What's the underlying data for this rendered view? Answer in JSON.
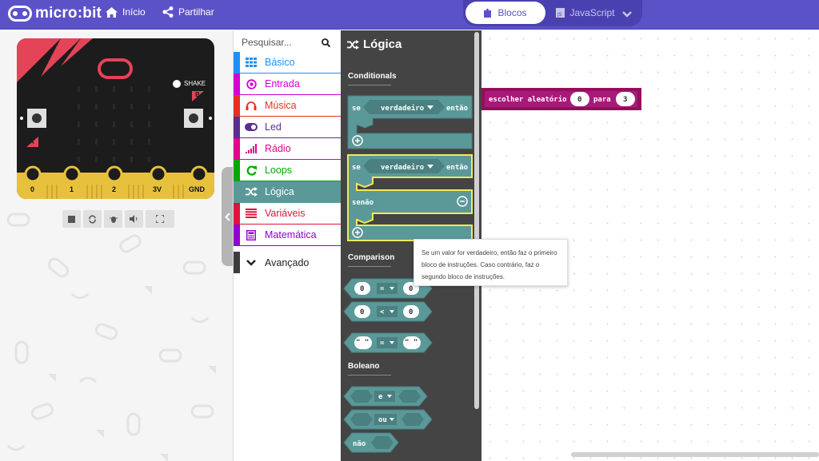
{
  "header": {
    "brand": "micro:bit",
    "home_label": "Início",
    "share_label": "Partilhar",
    "blocks_label": "Blocos",
    "javascript_label": "JavaScript",
    "accent": "#5c52c8"
  },
  "simulator": {
    "shake_label": "SHAKE",
    "button_a": "A",
    "button_b": "B",
    "pins": [
      "0",
      "1",
      "2",
      "3V",
      "GND"
    ],
    "toolbar_icons": [
      "stop-icon",
      "restart-icon",
      "debug-icon",
      "sound-icon",
      "fullscreen-icon"
    ]
  },
  "toolbox": {
    "search_placeholder": "Pesquisar...",
    "categories": [
      {
        "label": "Básico",
        "color": "#1e90ff",
        "icon": "grid-icon"
      },
      {
        "label": "Entrada",
        "color": "#d400d4",
        "icon": "target-icon"
      },
      {
        "label": "Música",
        "color": "#e63022",
        "icon": "headphones-icon"
      },
      {
        "label": "Led",
        "color": "#5c2d91",
        "icon": "toggle-icon"
      },
      {
        "label": "Rádio",
        "color": "#e3008c",
        "icon": "signal-bars-icon"
      },
      {
        "label": "Loops",
        "color": "#00aa00",
        "icon": "loop-icon"
      },
      {
        "label": "Lógica",
        "color": "#5b9999",
        "icon": "shuffle-icon"
      },
      {
        "label": "Variáveis",
        "color": "#dc143c",
        "icon": "list-lines-icon"
      },
      {
        "label": "Matemática",
        "color": "#9400d3",
        "icon": "calculator-icon"
      }
    ],
    "advanced_label": "Avançado"
  },
  "flyout": {
    "title": "Lógica",
    "sections": {
      "conditionals": "Conditionals",
      "comparison": "Comparison",
      "boolean": "Boleano"
    },
    "if_block": {
      "keyword": "se",
      "condition": "verdadeiro",
      "then": "então",
      "else": "senão"
    },
    "compare": [
      {
        "left": "0",
        "op": "=",
        "right": "0"
      },
      {
        "left": "0",
        "op": "<",
        "right": "0"
      },
      {
        "left": "\" \"",
        "op": "=",
        "right": "\" \""
      }
    ],
    "boolean_ops": [
      "e",
      "ou",
      "não"
    ],
    "block_color": "#5b9999"
  },
  "workspace": {
    "block": {
      "text": "escolher aleatório",
      "from": "0",
      "to_label": "para",
      "to": "3",
      "color": "#9a0e5a"
    }
  },
  "tooltip": {
    "text": "Se um valor for verdadeiro, então faz o primeiro bloco de instruções. Caso contrário, faz o segundo bloco de instruções."
  }
}
